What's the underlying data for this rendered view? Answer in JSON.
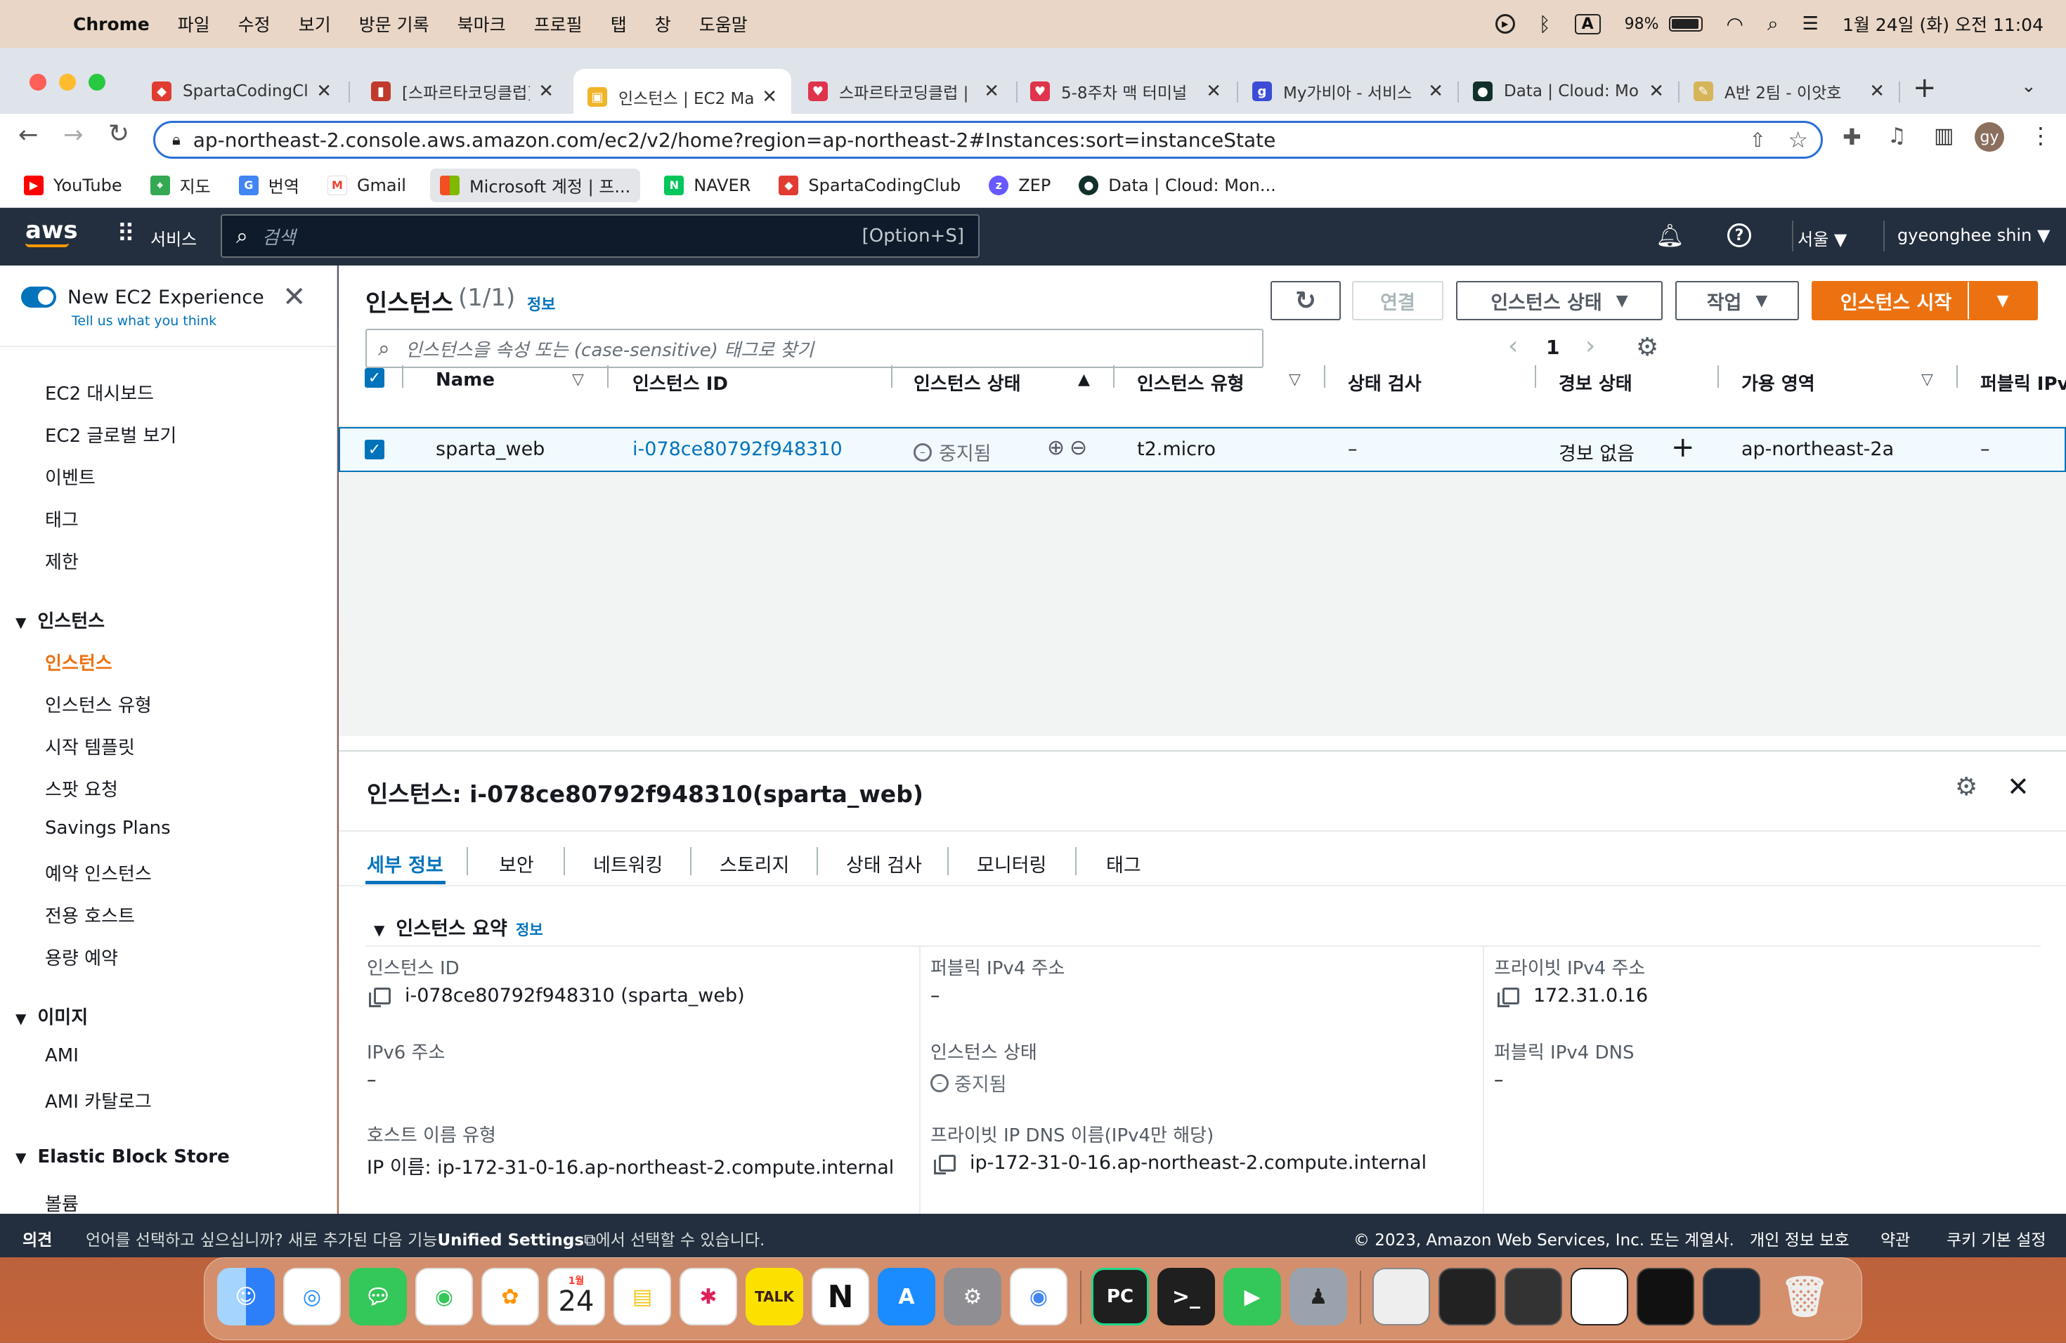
{
  "menubar": {
    "app": "Chrome",
    "items": [
      "파일",
      "수정",
      "보기",
      "방문 기록",
      "북마크",
      "프로필",
      "탭",
      "창",
      "도움말"
    ],
    "battery": "98%",
    "datetime": "1월 24일 (화) 오전 11:04",
    "input_indicator": "A"
  },
  "tabs": [
    {
      "title": "SpartaCodingCl",
      "fav_color": "#e03c31"
    },
    {
      "title": "[스파르타코딩클럽]",
      "fav_color": "#c0392b"
    },
    {
      "title": "인스턴스 | EC2 Ma",
      "fav_color": "#f0b429"
    },
    {
      "title": "스파르타코딩클럽 |",
      "fav_color": "#e0334c"
    },
    {
      "title": "5-8주차 맥 터미널",
      "fav_color": "#e0334c"
    },
    {
      "title": "My가비아 - 서비스",
      "fav_color": "#3b4dd6"
    },
    {
      "title": "Data | Cloud: Mo",
      "fav_color": "#12302b"
    },
    {
      "title": "A반 2팀 - 이앗호",
      "fav_color": "#d6b45a"
    }
  ],
  "address": {
    "url": "ap-northeast-2.console.aws.amazon.com/ec2/v2/home?region=ap-northeast-2#Instances:sort=instanceState"
  },
  "profile_initials": "gy",
  "bookmarks": [
    "YouTube",
    "지도",
    "번역",
    "Gmail",
    "Microsoft 계정 | 프...",
    "NAVER",
    "SpartaCodingClub",
    "ZEP",
    "Data | Cloud: Mon..."
  ],
  "aws": {
    "logo": "aws",
    "services": "서비스",
    "search_placeholder": "검색",
    "search_shortcut": "[Option+S]",
    "region": "서울",
    "user": "gyeonghee shin"
  },
  "sidebar": {
    "new_exp_title": "New EC2 Experience",
    "new_exp_link": "Tell us what you think",
    "top_items": [
      "EC2 대시보드",
      "EC2 글로벌 보기",
      "이벤트",
      "태그",
      "제한"
    ],
    "group_instances": "인스턴스",
    "instances_items": [
      "인스턴스",
      "인스턴스 유형",
      "시작 템플릿",
      "스팟 요청",
      "Savings Plans",
      "예약 인스턴스",
      "전용 호스트",
      "용량 예약"
    ],
    "group_images": "이미지",
    "images_items": [
      "AMI",
      "AMI 카탈로그"
    ],
    "group_ebs": "Elastic Block Store",
    "ebs_items": [
      "볼륨"
    ]
  },
  "main": {
    "title": "인스턴스",
    "count": "(1/1)",
    "info": "정보",
    "btn_connect": "연결",
    "btn_state": "인스턴스 상태",
    "btn_actions": "작업",
    "btn_launch": "인스턴스 시작",
    "filter_placeholder": "인스턴스을 속성 또는 (case-sensitive) 태그로 찾기",
    "page": "1",
    "columns": [
      "Name",
      "인스턴스 ID",
      "인스턴스 상태",
      "인스턴스 유형",
      "상태 검사",
      "경보 상태",
      "가용 영역",
      "퍼블릭 IPv"
    ],
    "row": {
      "name": "sparta_web",
      "id": "i-078ce80792f948310",
      "state": "중지됨",
      "type": "t2.micro",
      "status_check": "–",
      "alarm": "경보 없음",
      "az": "ap-northeast-2a",
      "public_ip": "–"
    }
  },
  "detail": {
    "title": "인스턴스: i-078ce80792f948310(sparta_web)",
    "tabs": [
      "세부 정보",
      "보안",
      "네트워킹",
      "스토리지",
      "상태 검사",
      "모니터링",
      "태그"
    ],
    "section": "인스턴스 요약",
    "section_info": "정보",
    "fields": {
      "instance_id_label": "인스턴스 ID",
      "instance_id": "i-078ce80792f948310 (sparta_web)",
      "public_ipv4_label": "퍼블릭 IPv4 주소",
      "public_ipv4": "–",
      "private_ipv4_label": "프라이빗 IPv4 주소",
      "private_ipv4": "172.31.0.16",
      "ipv6_label": "IPv6 주소",
      "ipv6": "–",
      "state_label": "인스턴스 상태",
      "state": "중지됨",
      "public_dns_label": "퍼블릭 IPv4 DNS",
      "public_dns": "–",
      "hostname_type_label": "호스트 이름 유형",
      "hostname_type": "IP 이름: ip-172-31-0-16.ap-northeast-2.compute.internal",
      "private_dns_label": "프라이빗 IP DNS 이름(IPv4만 해당)",
      "private_dns": "ip-172-31-0-16.ap-northeast-2.compute.internal"
    }
  },
  "footer": {
    "feedback": "의견",
    "lang_msg_pre": "언어를 선택하고 싶으십니까? 새로 추가된 다음 기능",
    "lang_msg_link": "Unified Settings",
    "lang_msg_post": "에서 선택할 수 있습니다.",
    "copyright": "© 2023, Amazon Web Services, Inc. 또는 계열사.",
    "privacy": "개인 정보 보호",
    "terms": "약관",
    "cookies": "쿠키 기본 설정"
  },
  "dock": {
    "calendar_month": "1월",
    "calendar_day": "24",
    "pycharm": "PC",
    "kakaotalk": "TALK"
  },
  "colors": {
    "aws_orange": "#ec7211",
    "aws_nav": "#232f3e",
    "link_blue": "#0073bb",
    "chrome_focus": "#2b6fd6"
  }
}
